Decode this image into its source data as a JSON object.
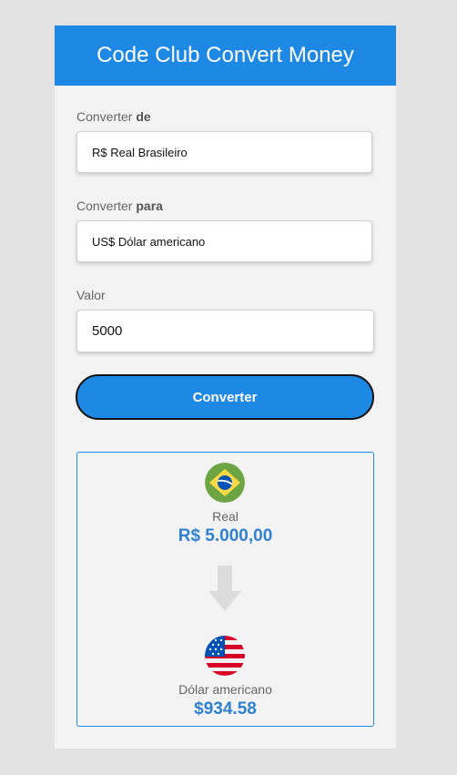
{
  "header": {
    "title": "Code Club Convert Money"
  },
  "from_field": {
    "label_prefix": "Converter ",
    "label_bold": "de",
    "selected": "R$ Real Brasileiro"
  },
  "to_field": {
    "label_prefix": "Converter ",
    "label_bold": "para",
    "selected": "US$ Dólar americano"
  },
  "amount_field": {
    "label": "Valor",
    "value": "5000"
  },
  "convert_button": {
    "label": "Converter"
  },
  "result": {
    "from": {
      "name": "Real",
      "value": "R$ 5.000,00",
      "flag": "brazil-flag"
    },
    "to": {
      "name": "Dólar americano",
      "value": "$934.58",
      "flag": "usa-flag"
    }
  },
  "colors": {
    "accent": "#1e88e5",
    "result_value": "#2f80d1",
    "page_bg": "#e3e3e3",
    "card_bg": "#f3f3f3"
  }
}
